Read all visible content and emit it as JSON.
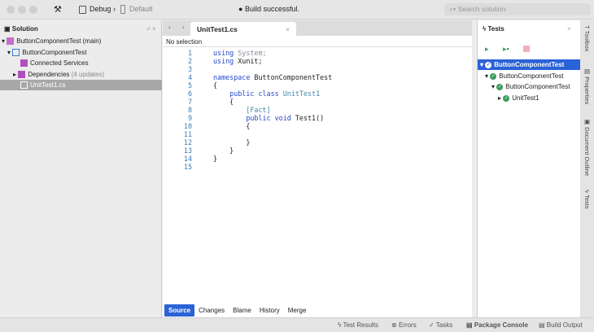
{
  "toolbar": {
    "config": "Debug",
    "device": "Default",
    "status": "Build successful.",
    "search_placeholder": "Search solution"
  },
  "solution": {
    "title": "Solution",
    "items": [
      {
        "label": "ButtonComponentTest (main)"
      },
      {
        "label": "ButtonComponentTest"
      },
      {
        "label": "Connected Services"
      },
      {
        "label": "Dependencies",
        "note": "(4 updates)"
      },
      {
        "label": "UnitTest1.cs"
      }
    ]
  },
  "editor": {
    "tab": "UnitTest1.cs",
    "selection": "No selection",
    "lines": [
      {
        "n": "1",
        "parts": [
          [
            "kw",
            "using "
          ],
          [
            "gr",
            "System;"
          ]
        ]
      },
      {
        "n": "2",
        "parts": [
          [
            "kw",
            "using "
          ],
          [
            "",
            "Xunit;"
          ]
        ]
      },
      {
        "n": "3",
        "parts": []
      },
      {
        "n": "4",
        "parts": [
          [
            "kw",
            "namespace "
          ],
          [
            "",
            "ButtonComponentTest"
          ]
        ]
      },
      {
        "n": "5",
        "parts": [
          [
            "",
            "{"
          ]
        ]
      },
      {
        "n": "6",
        "parts": [
          [
            "",
            "    "
          ],
          [
            "kw",
            "public class "
          ],
          [
            "ty",
            "UnitTest1"
          ]
        ]
      },
      {
        "n": "7",
        "parts": [
          [
            "",
            "    {"
          ]
        ]
      },
      {
        "n": "8",
        "parts": [
          [
            "",
            "        "
          ],
          [
            "ty",
            "[Fact]"
          ]
        ]
      },
      {
        "n": "9",
        "parts": [
          [
            "",
            "        "
          ],
          [
            "kw",
            "public void "
          ],
          [
            "",
            "Test1()"
          ]
        ]
      },
      {
        "n": "10",
        "parts": [
          [
            "",
            "        {"
          ]
        ]
      },
      {
        "n": "11",
        "parts": []
      },
      {
        "n": "12",
        "parts": [
          [
            "",
            "        }"
          ]
        ]
      },
      {
        "n": "13",
        "parts": [
          [
            "",
            "    }"
          ]
        ]
      },
      {
        "n": "14",
        "parts": [
          [
            "",
            "}"
          ]
        ]
      },
      {
        "n": "15",
        "parts": []
      }
    ],
    "bottom_tabs": [
      "Source",
      "Changes",
      "Blame",
      "History",
      "Merge"
    ]
  },
  "tests": {
    "title": "Tests",
    "items": [
      "ButtonComponentTest",
      "ButtonComponentTest",
      "ButtonComponentTest",
      "UnitTest1"
    ]
  },
  "side": [
    "Toolbox",
    "Properties",
    "Document Outline",
    "Tests"
  ],
  "statusbar": [
    "Test Results",
    "Errors",
    "Tasks",
    "Package Console",
    "Build Output"
  ]
}
